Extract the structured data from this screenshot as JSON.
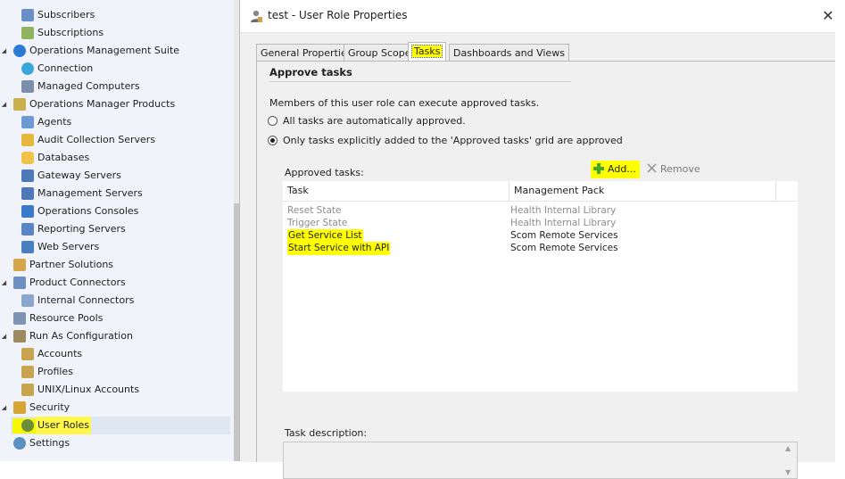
{
  "nav": {
    "items": [
      {
        "label": "Subscribers",
        "icon": "subscribers-icon"
      },
      {
        "label": "Subscriptions",
        "icon": "subscriptions-icon"
      },
      {
        "label": "Operations Management Suite",
        "icon": "oms-icon"
      },
      {
        "label": "Connection",
        "icon": "connection-icon"
      },
      {
        "label": "Managed Computers",
        "icon": "managed-computers-icon"
      },
      {
        "label": "Operations Manager Products",
        "icon": "products-icon"
      },
      {
        "label": "Agents",
        "icon": "agents-icon"
      },
      {
        "label": "Audit Collection Servers",
        "icon": "audit-collection-icon"
      },
      {
        "label": "Databases",
        "icon": "database-icon"
      },
      {
        "label": "Gateway Servers",
        "icon": "gateway-server-icon"
      },
      {
        "label": "Management Servers",
        "icon": "management-server-icon"
      },
      {
        "label": "Operations Consoles",
        "icon": "console-icon"
      },
      {
        "label": "Reporting Servers",
        "icon": "reporting-server-icon"
      },
      {
        "label": "Web Servers",
        "icon": "web-server-icon"
      },
      {
        "label": "Partner Solutions",
        "icon": "partner-solutions-icon"
      },
      {
        "label": "Product Connectors",
        "icon": "product-connectors-icon"
      },
      {
        "label": "Internal Connectors",
        "icon": "internal-connectors-icon"
      },
      {
        "label": "Resource Pools",
        "icon": "resource-pools-icon"
      },
      {
        "label": "Run As Configuration",
        "icon": "run-as-icon"
      },
      {
        "label": "Accounts",
        "icon": "accounts-icon"
      },
      {
        "label": "Profiles",
        "icon": "profiles-icon"
      },
      {
        "label": "UNIX/Linux Accounts",
        "icon": "unix-accounts-icon"
      },
      {
        "label": "Security",
        "icon": "lock-icon"
      },
      {
        "label": "User Roles",
        "icon": "user-roles-icon"
      },
      {
        "label": "Settings",
        "icon": "settings-icon"
      }
    ]
  },
  "dialog": {
    "title": "test - User Role Properties",
    "close_label": "✕",
    "tabs": [
      {
        "label": "General Properties"
      },
      {
        "label": "Group Scope"
      },
      {
        "label": "Tasks"
      },
      {
        "label": "Dashboards and Views"
      }
    ],
    "section_title": "Approve tasks",
    "description": "Members of this user role can execute approved tasks.",
    "radio_all": "All tasks are automatically approved.",
    "radio_only": "Only tasks explicitly added to the 'Approved tasks' grid are approved",
    "approved_label": "Approved tasks:",
    "add_label": "Add...",
    "remove_label": "Remove",
    "grid": {
      "columns": [
        "Task",
        "Management Pack"
      ],
      "rows": [
        {
          "task": "Reset State",
          "pack": "Health Internal Library"
        },
        {
          "task": "Trigger State",
          "pack": "Health Internal Library"
        },
        {
          "task": "Get Service List",
          "pack": "Scom Remote Services"
        },
        {
          "task": "Start Service with API",
          "pack": "Scom Remote Services"
        }
      ]
    },
    "task_description_label": "Task description:"
  },
  "colors": {
    "highlight": "#ffff00",
    "nav_bg": "#f0f4fa",
    "dialog_bg": "#f0f0f0"
  }
}
